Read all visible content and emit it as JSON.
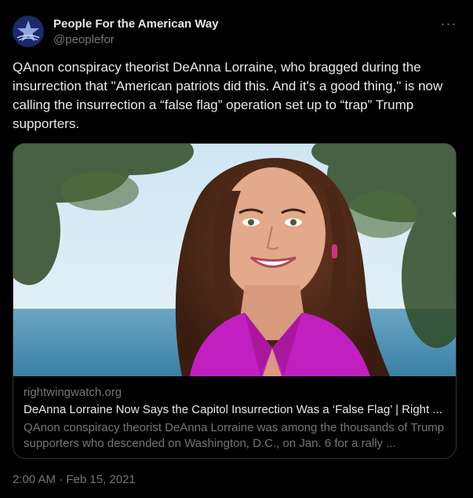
{
  "author": {
    "name": "People For the American Way",
    "handle": "@peoplefor",
    "avatar_icon": "star-logo-icon"
  },
  "more_label": "···",
  "tweet_text": "QAnon conspiracy theorist DeAnna Lorraine, who bragged during the insurrection that \"American patriots did this. And it's a good thing,\" is now calling the insurrection a “false flag” operation set up to “trap” Trump supporters.",
  "link_card": {
    "domain": "rightwingwatch.org",
    "title": "DeAnna Lorraine Now Says the Capitol Insurrection Was a ‘False Flag’ | Right ...",
    "description": "QAnon conspiracy theorist DeAnna Lorraine was among the thousands of Trump supporters who descended on Washington, D.C., on Jan. 6 for a rally ..."
  },
  "timestamp": "2:00 AM · Feb 15, 2021",
  "colors": {
    "background": "#000000",
    "text_primary": "#e7e9ea",
    "text_secondary": "#71767b",
    "border": "#2f3336",
    "jacket": "#c21fc0"
  }
}
